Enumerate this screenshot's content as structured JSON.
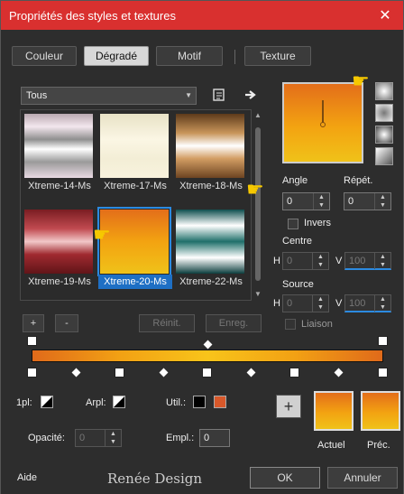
{
  "window": {
    "title": "Propriétés des styles et textures",
    "close": "✕"
  },
  "tabs": [
    {
      "label": "Couleur"
    },
    {
      "label": "Dégradé"
    },
    {
      "label": "Motif"
    },
    {
      "label": "Texture"
    }
  ],
  "category": {
    "value": "Tous"
  },
  "gradients": [
    {
      "name": "Xtreme-14-Ms",
      "colors": [
        "#b9a8b0",
        "#f3e7ee",
        "#8f8f8f",
        "#ffffff",
        "#9a9a9a",
        "#e8d9e2"
      ]
    },
    {
      "name": "Xtreme-17-Ms",
      "colors": [
        "#e8e2c6",
        "#fbf6e4",
        "#f3eed6",
        "#f8f2dd"
      ]
    },
    {
      "name": "Xtreme-18-Ms",
      "colors": [
        "#5d3a1b",
        "#c8955a",
        "#ffffff",
        "#d29d63",
        "#6d4421"
      ]
    },
    {
      "name": "Xtreme-19-Ms",
      "colors": [
        "#7a1d22",
        "#c14a50",
        "#f2c8c8",
        "#a02a30",
        "#601518"
      ]
    },
    {
      "name": "Xtreme-20-Ms",
      "colors": [
        "#e36e1a",
        "#f3a311",
        "#f0c219"
      ]
    },
    {
      "name": "Xtreme-22-Ms",
      "colors": [
        "#0e4f4f",
        "#ffffff",
        "#1f6f6a",
        "#ffffff",
        "#0c3e3e"
      ]
    }
  ],
  "buttons": {
    "add": "+",
    "remove": "-",
    "reset": "Réinit.",
    "save": "Enreg.",
    "ok": "OK",
    "cancel": "Annuler",
    "help": "Aide",
    "plus": "+"
  },
  "angle": {
    "label": "Angle",
    "value": "0"
  },
  "repeat": {
    "label": "Répét.",
    "value": "0"
  },
  "invert": {
    "label": "Invers"
  },
  "center": {
    "label": "Centre",
    "h_label": "H",
    "h_value": "0",
    "v_label": "V",
    "v_value": "100"
  },
  "source": {
    "label": "Source",
    "h_label": "H",
    "h_value": "0",
    "v_label": "V",
    "v_value": "100"
  },
  "link": {
    "label": "Liaison"
  },
  "stops": {
    "first_label": "1pl:",
    "arpl_label": "Arpl:",
    "util_label": "Util.:",
    "util_color1": "#000000",
    "util_color2": "#d8582a",
    "opacity_label": "Opacité:",
    "opacity_value": "0",
    "empl_label": "Empl.:",
    "empl_value": "0"
  },
  "preview": {
    "current_label": "Actuel",
    "previous_label": "Préc."
  },
  "watermark": "Renée Design"
}
